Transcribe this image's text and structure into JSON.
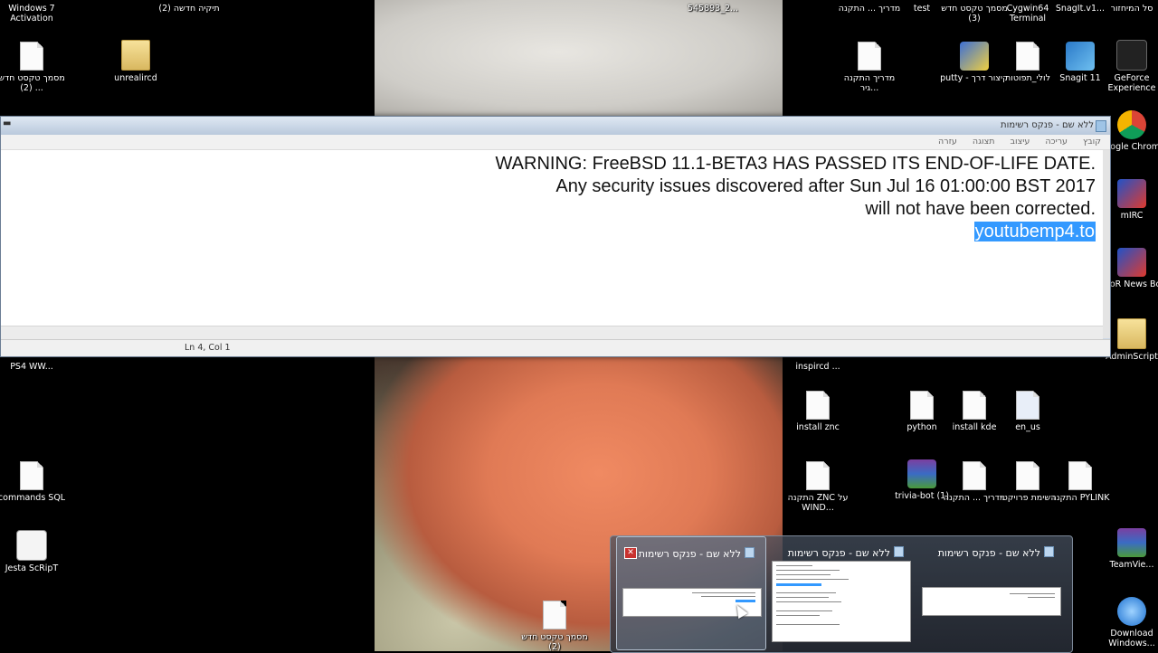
{
  "desktop": {
    "icons": {
      "win7_activation": "Windows 7 Activation",
      "new_folder_2": "תיקיה חדשה (2)",
      "file_545893": "545893_2...",
      "guide_install": "מדריך ... התקנה",
      "test": "test",
      "new_text_3": "מסמך טקסט חדש (3)",
      "cygwin": "Cygwin64 Terminal",
      "snagit_v1": "SnagIt.v1...",
      "trash": "סל המיחזור",
      "new_text_2": "מסמך טקסט חדש (2) ...",
      "unrealircd": "unrealircd",
      "guide_install_gir": "מדריך התקנה גיר...",
      "putty_shortcut": "putty - קיצור דרך",
      "loli_tfutot": "לולי_תפוטות",
      "snagit11": "Snagit 11",
      "geforce": "GeForce Experience",
      "chrome": "Google Chrome",
      "mirc": "mIRC",
      "zxor": "ZxoR News Bot",
      "adminscript": "AdminScript",
      "ps4": "PS4 WW...",
      "inspircd": "inspircd ...",
      "install_znc": "install znc",
      "python": "python",
      "install_kde": "install kde",
      "en_us": "en_us",
      "commands_sql": "commands SQL",
      "znc_install": "התקנה ZNC על WIND...",
      "trivia_bot": "trivia-bot (1)",
      "guide_install2": "מדריך ... התקנה",
      "project_list": "רשימת פרויקטי",
      "pylink": "התקנה PYLINK",
      "jesta": "Jesta ScRipT",
      "new_text_2b": "מסמך טקסט חדש (2)",
      "teamviewer": "TeamVie...",
      "download_windows": "Download Windows..."
    }
  },
  "notepad": {
    "title": "ללא שם - פנקס רשימות",
    "menu": [
      "קובץ",
      "עריכה",
      "עיצוב",
      "תצוגה",
      "עזרה"
    ],
    "lines": [
      ".WARNING: FreeBSD 11.1-BETA3 HAS PASSED ITS END-OF-LIFE DATE",
      "Any security issues discovered after Sun Jul 16 01:00:00 BST 2017",
      ".will not have been corrected"
    ],
    "selected_line": "youtubemp4.to",
    "status": "Ln 4, Col 1"
  },
  "taskbar_preview": {
    "windows": [
      {
        "title": "ללא שם - פנקס רשימות",
        "close": "✕"
      },
      {
        "title": "ללא שם - פנקס רשימות"
      },
      {
        "title": "ללא שם - פנקס רשימות"
      }
    ]
  }
}
